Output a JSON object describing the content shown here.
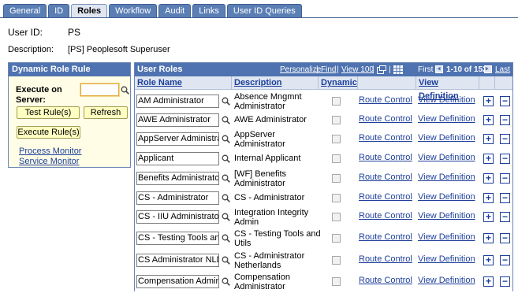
{
  "tabs": [
    {
      "label": "General",
      "active": false
    },
    {
      "label": "ID",
      "active": false
    },
    {
      "label": "Roles",
      "active": true
    },
    {
      "label": "Workflow",
      "active": false
    },
    {
      "label": "Audit",
      "active": false
    },
    {
      "label": "Links",
      "active": false
    },
    {
      "label": "User ID Queries",
      "active": false
    }
  ],
  "header": {
    "user_id_label": "User ID:",
    "user_id_value": "PS",
    "description_label": "Description:",
    "description_value": "[PS] Peoplesoft Superuser"
  },
  "dynamic_role_rule": {
    "title": "Dynamic Role Rule",
    "execute_label": "Execute on Server:",
    "execute_value": "",
    "test_button": "Test Rule(s)",
    "refresh_button": "Refresh",
    "execute_button": "Execute Rule(s)",
    "process_monitor": "Process Monitor",
    "service_monitor": "Service Monitor"
  },
  "user_roles": {
    "title": "User Roles",
    "personalize": "Personalize",
    "find": "Find",
    "view": "View 100",
    "first": "First",
    "range": "1-10 of 152",
    "last": "Last",
    "columns": {
      "role_name": "Role Name",
      "description": "Description",
      "dynamic": "Dynamic",
      "view_definition": "View Definition"
    },
    "rows": [
      {
        "role": "AM Administrator",
        "desc": "Absence Mngmnt Administrator",
        "route": "Route Control",
        "view": "View Definition"
      },
      {
        "role": "AWE Administrator",
        "desc": "AWE Administrator",
        "route": "Route Control",
        "view": "View Definition"
      },
      {
        "role": "AppServer Administrator",
        "desc": "AppServer Administrator",
        "route": "Route Control",
        "view": "View Definition"
      },
      {
        "role": "Applicant",
        "desc": "Internal Applicant",
        "route": "Route Control",
        "view": "View Definition"
      },
      {
        "role": "Benefits Administrator",
        "desc": "[WF] Benefits Administrator",
        "route": "Route Control",
        "view": "View Definition"
      },
      {
        "role": "CS - Administrator",
        "desc": "CS - Administrator",
        "route": "Route Control",
        "view": "View Definition"
      },
      {
        "role": "CS - IIU Administrator",
        "desc": "Integration Integrity Admin",
        "route": "Route Control",
        "view": "View Definition"
      },
      {
        "role": "CS - Testing Tools and",
        "desc": "CS - Testing Tools and Utils",
        "route": "Route Control",
        "view": "View Definition"
      },
      {
        "role": "CS Administrator NLD",
        "desc": "CS - Administrator Netherlands",
        "route": "Route Control",
        "view": "View Definition"
      },
      {
        "role": "Compensation Administrator",
        "desc": "Compensation Administrator",
        "route": "Route Control",
        "view": "View Definition"
      }
    ],
    "add_icon": "+",
    "remove_icon": "−"
  },
  "colors": {
    "tab_bg": "#5b7fb5",
    "header_bar": "#4f73b0",
    "link": "#1d3f9a",
    "panel_bg": "#fffde6",
    "button_bg": "#ffffc2"
  }
}
